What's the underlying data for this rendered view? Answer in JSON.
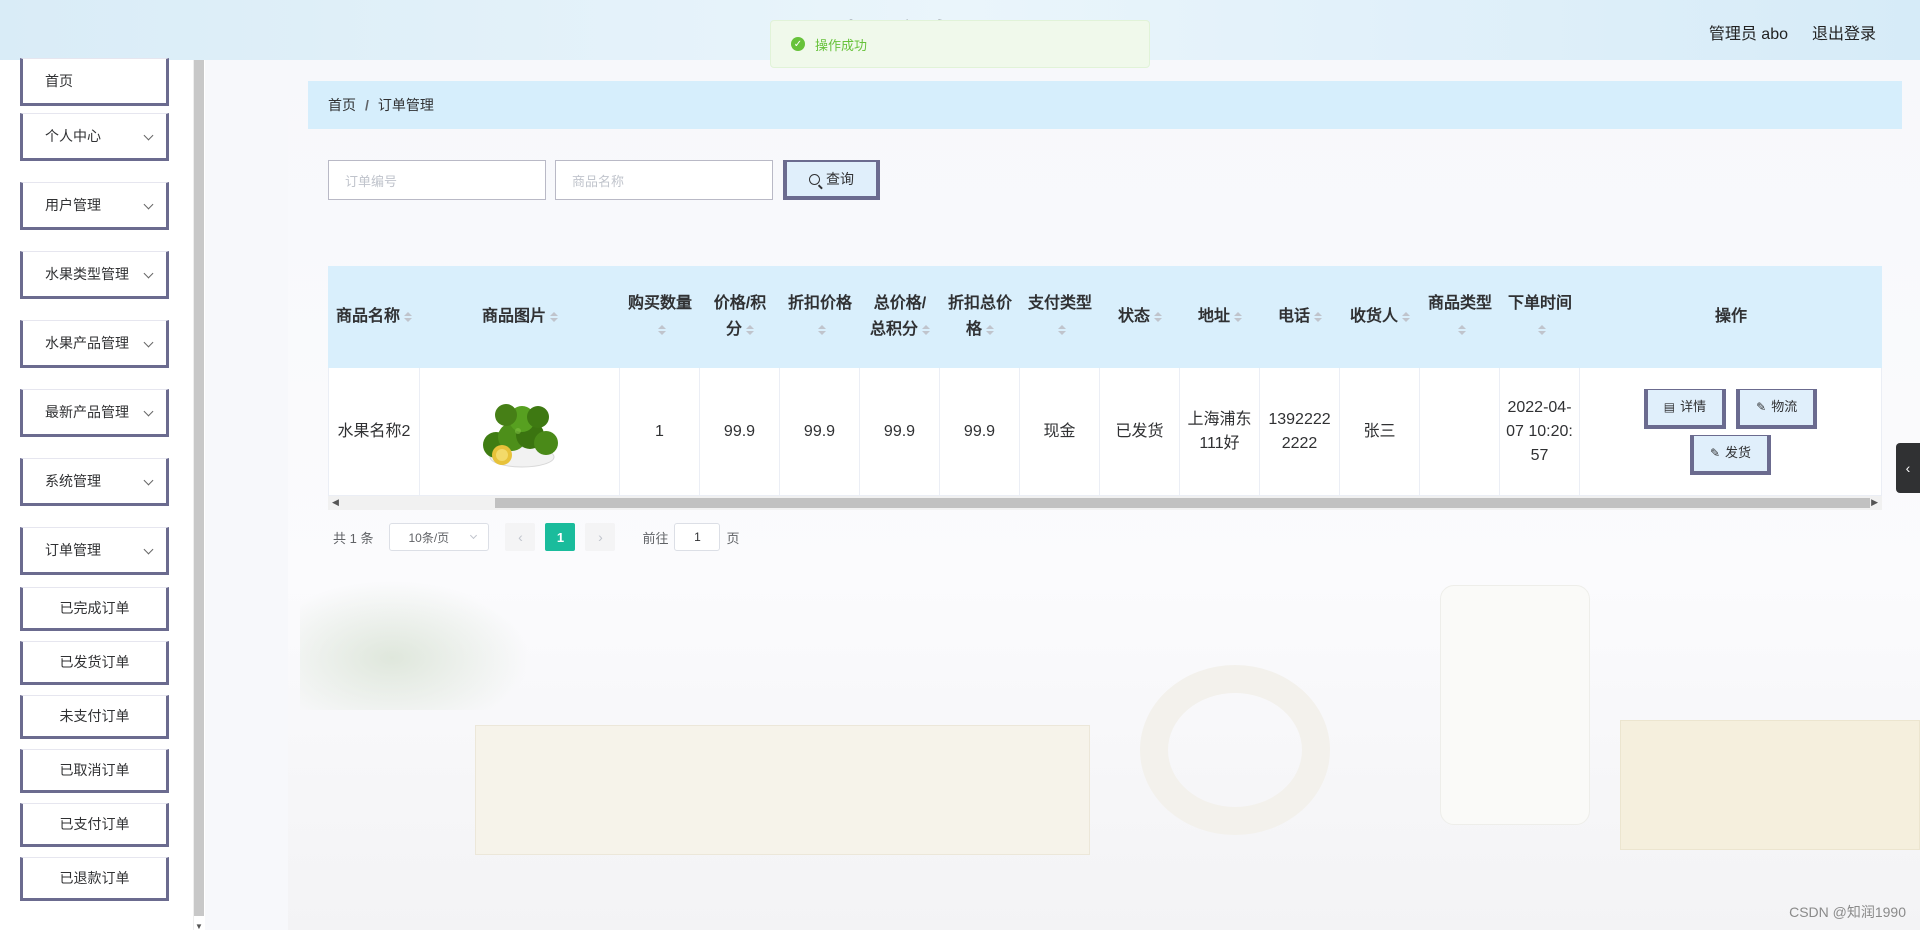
{
  "header": {
    "title": "水果商城",
    "user": "管理员 abo",
    "logout": "退出登录"
  },
  "toast": {
    "message": "操作成功"
  },
  "sidebar": {
    "items": [
      {
        "label": "首页"
      },
      {
        "label": "个人中心"
      },
      {
        "label": "用户管理"
      },
      {
        "label": "水果类型管理"
      },
      {
        "label": "水果产品管理"
      },
      {
        "label": "最新产品管理"
      },
      {
        "label": "系统管理"
      },
      {
        "label": "订单管理"
      }
    ],
    "sub_items": [
      {
        "label": "已完成订单"
      },
      {
        "label": "已发货订单"
      },
      {
        "label": "未支付订单"
      },
      {
        "label": "已取消订单"
      },
      {
        "label": "已支付订单"
      },
      {
        "label": "已退款订单"
      }
    ]
  },
  "breadcrumb": {
    "home": "首页",
    "separator": "/",
    "current": "订单管理"
  },
  "search": {
    "order_no_placeholder": "订单编号",
    "product_name_placeholder": "商品名称",
    "button": "查询"
  },
  "table": {
    "headers": [
      "商品名称",
      "商品图片",
      "购买数量",
      "价格/积分",
      "折扣价格",
      "总价格/总积分",
      "折扣总价格",
      "支付类型",
      "状态",
      "地址",
      "电话",
      "收货人",
      "商品类型",
      "下单时间",
      "操作"
    ],
    "rows": [
      {
        "name": "水果名称2",
        "image": "green-lime-fruit-bowl",
        "qty": "1",
        "price": "99.9",
        "discount_price": "99.9",
        "total": "99.9",
        "discount_total": "99.9",
        "pay_type": "现金",
        "status": "已发货",
        "address": "上海浦东111好",
        "phone": "13922222222",
        "receiver": "张三",
        "type": "",
        "time": "2022-04-07 10:20:57",
        "actions": [
          "详情",
          "物流",
          "发货"
        ]
      }
    ]
  },
  "pagination": {
    "total": "共 1 条",
    "page_size": "10条/页",
    "current_page": "1",
    "goto_label": "前往",
    "goto_value": "1",
    "page_suffix": "页"
  },
  "watermark": "CSDN @知润1990",
  "colors": {
    "header_bg": "#d9effc",
    "active_page": "#1abc9c",
    "toast": "#67c23a",
    "button_border": "#6b6b8f"
  }
}
